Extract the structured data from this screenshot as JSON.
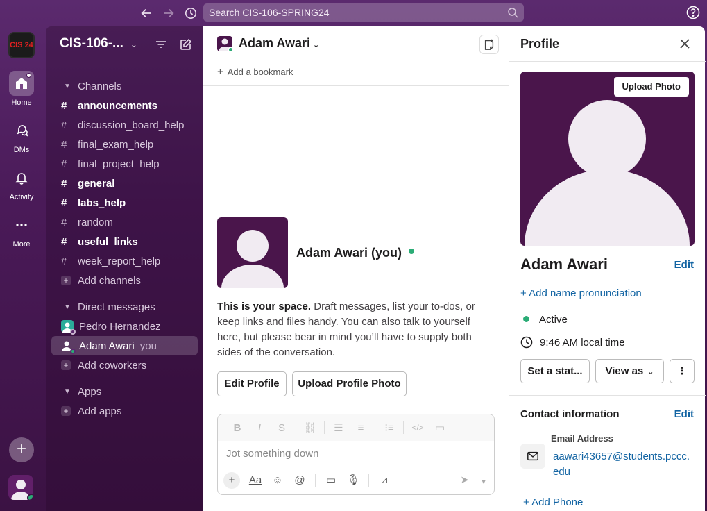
{
  "topbar": {
    "search_placeholder": "Search CIS-106-SPRING24"
  },
  "rail": {
    "workspace_logo_text": "CIS 24",
    "items": [
      {
        "label": "Home",
        "icon": "home-icon"
      },
      {
        "label": "DMs",
        "icon": "dms-icon"
      },
      {
        "label": "Activity",
        "icon": "bell-icon"
      },
      {
        "label": "More",
        "icon": "more-icon"
      }
    ]
  },
  "sidebar": {
    "workspace_name": "CIS-106-...",
    "channels_header": "Channels",
    "channels": [
      {
        "name": "announcements",
        "bold": true
      },
      {
        "name": "discussion_board_help",
        "bold": false
      },
      {
        "name": "final_exam_help",
        "bold": false
      },
      {
        "name": "final_project_help",
        "bold": false
      },
      {
        "name": "general",
        "bold": true
      },
      {
        "name": "labs_help",
        "bold": true
      },
      {
        "name": "random",
        "bold": false
      },
      {
        "name": "useful_links",
        "bold": true
      },
      {
        "name": "week_report_help",
        "bold": false
      }
    ],
    "add_channels": "Add channels",
    "dm_header": "Direct messages",
    "dms": [
      {
        "name": "Pedro Hernandez"
      },
      {
        "name": "Adam Awari",
        "suffix": "you"
      }
    ],
    "add_coworkers": "Add coworkers",
    "apps_header": "Apps",
    "add_apps": "Add apps"
  },
  "main": {
    "header_name": "Adam Awari",
    "add_bookmark": "Add a bookmark",
    "intro_name": "Adam Awari (you)",
    "intro_bold": "This is your space.",
    "intro_rest": " Draft messages, list your to-dos, or keep links and files handy. You can also talk to yourself here, but please bear in mind you’ll have to supply both sides of the conversation.",
    "edit_profile": "Edit Profile",
    "upload_profile_photo": "Upload Profile Photo",
    "composer_placeholder": "Jot something down"
  },
  "profile": {
    "title": "Profile",
    "upload_photo": "Upload Photo",
    "name": "Adam Awari",
    "edit": "Edit",
    "add_pronunciation": "Add name pronunciation",
    "status": "Active",
    "local_time": "9:46 AM local time",
    "set_status": "Set a stat...",
    "view_as": "View as",
    "contact_title": "Contact information",
    "contact_edit": "Edit",
    "email_label": "Email Address",
    "email": "aawari43657@students.pccc.edu",
    "add_phone": "Add Phone"
  },
  "colors": {
    "aubergine": "#4a154b",
    "online": "#2bac76",
    "link": "#1264a3"
  }
}
